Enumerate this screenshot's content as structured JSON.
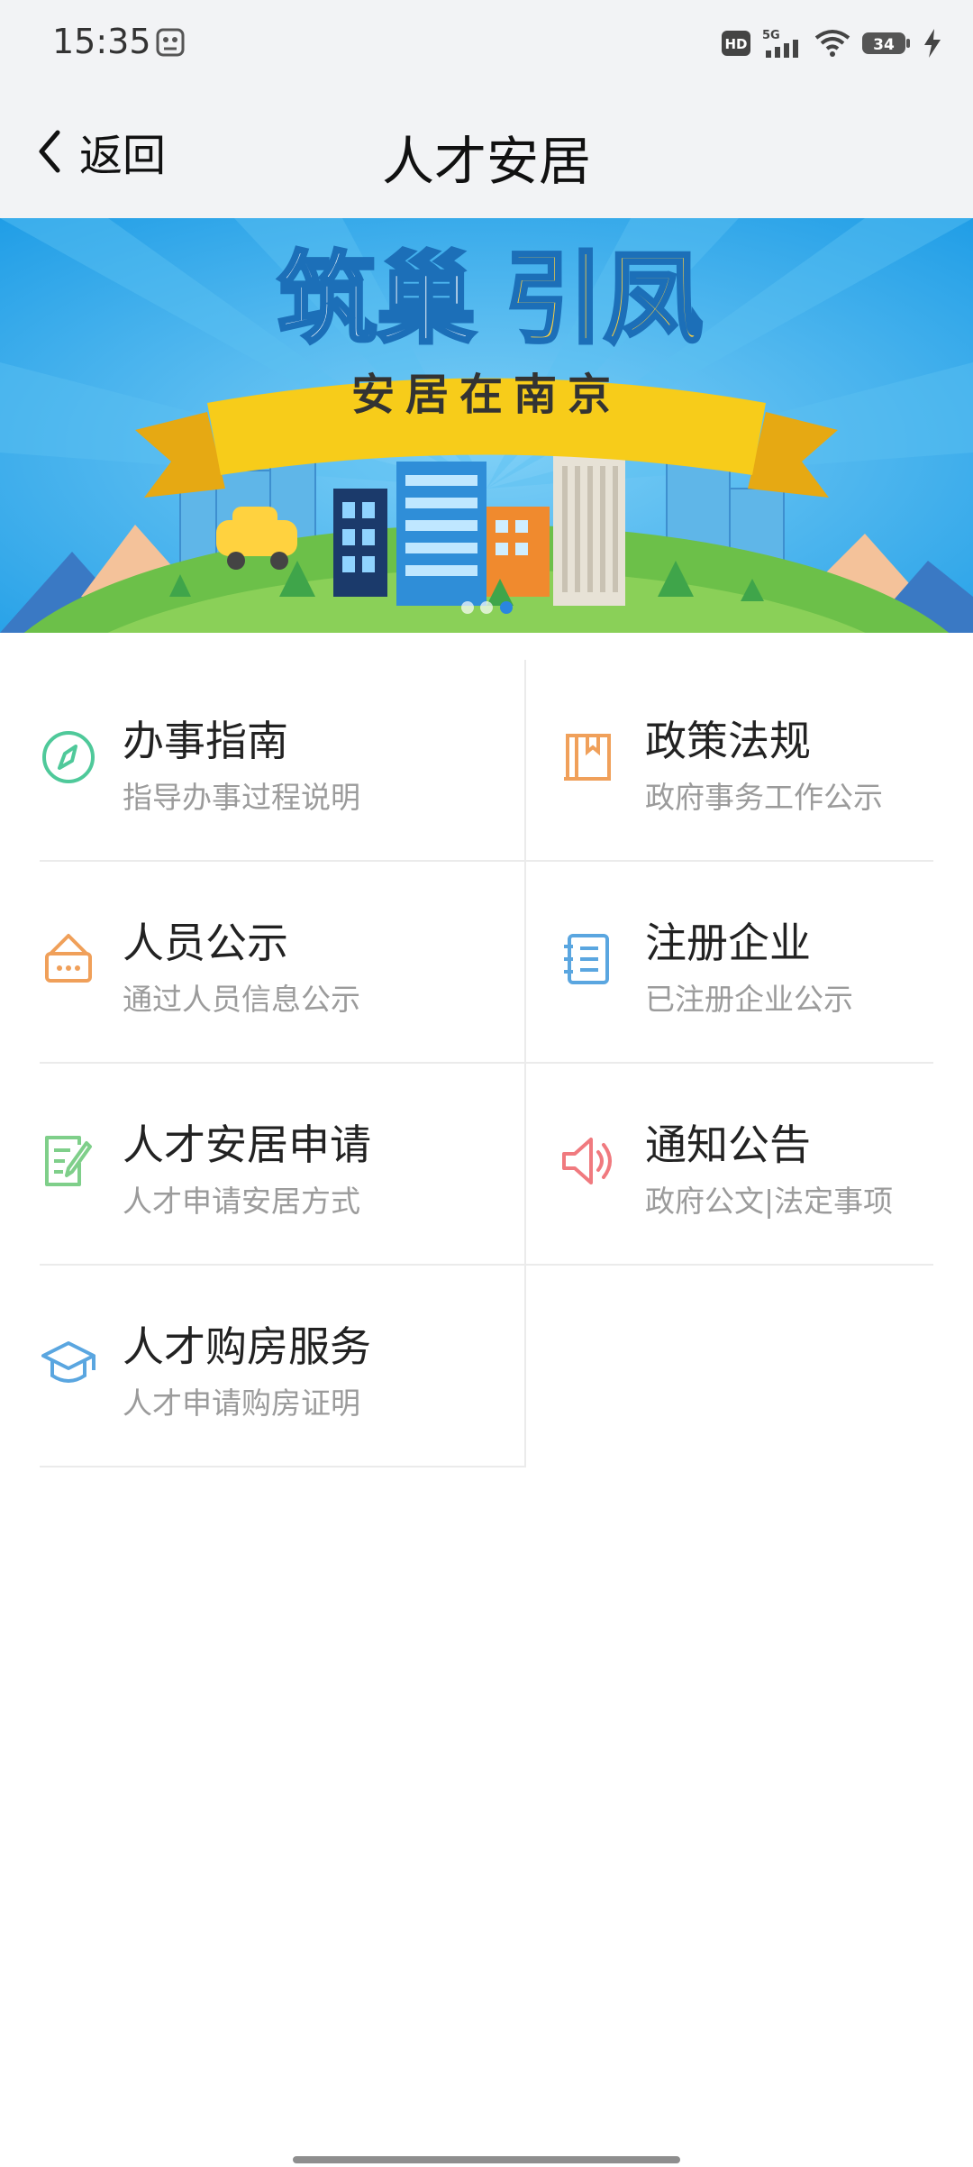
{
  "status_bar": {
    "time": "15:35",
    "icons": [
      "screenshot-icon",
      "hd-icon",
      "signal-5g-icon",
      "wifi-icon",
      "battery-icon",
      "charging-icon"
    ],
    "network": "5G",
    "battery": "34"
  },
  "nav": {
    "back_label": "返回",
    "title": "人才安居"
  },
  "banner": {
    "headline_part1": "筑巢",
    "headline_part2": "引凤",
    "ribbon_text": "安居在南京"
  },
  "menu": [
    {
      "title": "办事指南",
      "subtitle": "指导办事过程说明",
      "icon": "compass-icon",
      "color": "#4fc99a"
    },
    {
      "title": "政策法规",
      "subtitle": "政府事务工作公示",
      "icon": "book-icon",
      "color": "#f0a05a"
    },
    {
      "title": "人员公示",
      "subtitle": "通过人员信息公示",
      "icon": "signboard-icon",
      "color": "#f0a05a"
    },
    {
      "title": "注册企业",
      "subtitle": "已注册企业公示",
      "icon": "notebook-icon",
      "color": "#5aa6e0"
    },
    {
      "title": "人才安居申请",
      "subtitle": "人才申请安居方式",
      "icon": "form-edit-icon",
      "color": "#7fcf8a"
    },
    {
      "title": "通知公告",
      "subtitle": "政府公文|法定事项",
      "icon": "speaker-icon",
      "color": "#f07a7f"
    },
    {
      "title": "人才购房服务",
      "subtitle": "人才申请购房证明",
      "icon": "graduation-cap-icon",
      "color": "#5aa6e0"
    }
  ],
  "colors": {
    "bar_bg": "#f2f3f5",
    "banner_sky": "#2ea8ee",
    "ribbon": "#f7cc1a"
  }
}
